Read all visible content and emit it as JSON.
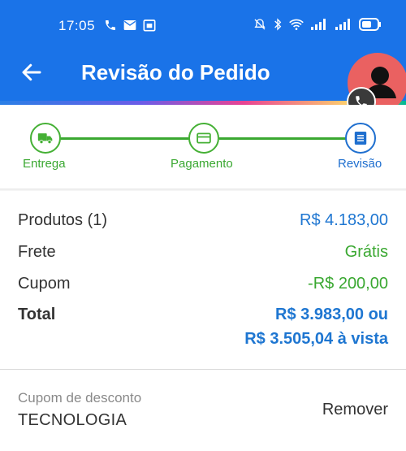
{
  "status_bar": {
    "time": "17:05"
  },
  "app_bar": {
    "title": "Revisão do Pedido",
    "colors": {
      "background": "#1a73e8",
      "avatar": "#ea6161"
    }
  },
  "stepper": {
    "steps": [
      {
        "label": "Entrega",
        "icon": "truck-icon",
        "state": "done"
      },
      {
        "label": "Pagamento",
        "icon": "card-icon",
        "state": "done"
      },
      {
        "label": "Revisão",
        "icon": "document-icon",
        "state": "active"
      }
    ]
  },
  "summary": {
    "products_label": "Produtos (1)",
    "products_value": "R$ 4.183,00",
    "shipping_label": "Frete",
    "shipping_value": "Grátis",
    "coupon_label": "Cupom",
    "coupon_value": "-R$ 200,00",
    "total_label": "Total",
    "total_value": "R$ 3.983,00 ou",
    "total_cash_value": "R$ 3.505,04 à vista"
  },
  "coupon": {
    "label": "Cupom de desconto",
    "code": "TECNOLOGIA",
    "remove_label": "Remover"
  }
}
